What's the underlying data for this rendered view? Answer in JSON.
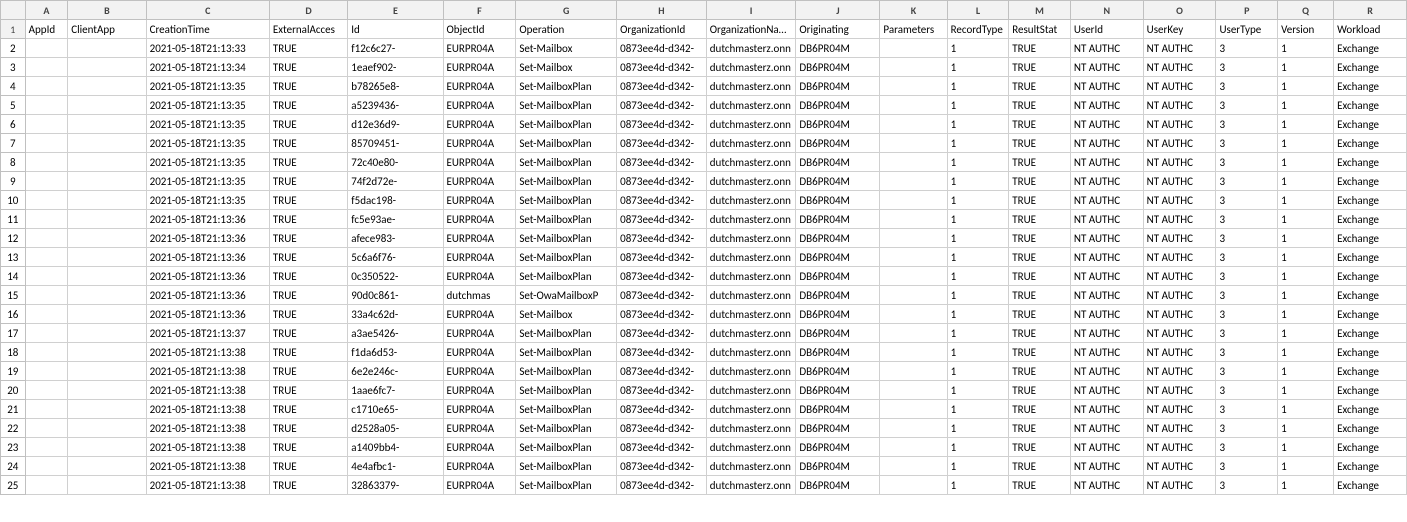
{
  "columns": {
    "letters": [
      "",
      "A",
      "B",
      "C",
      "D",
      "E",
      "F",
      "G",
      "H",
      "I",
      "J",
      "K",
      "L",
      "M",
      "N",
      "O",
      "P",
      "Q",
      "R"
    ],
    "headers": [
      "",
      "AppId",
      "ClientApp",
      "CreationTime",
      "ExternalAcces",
      "Id",
      "ObjectId",
      "Operation",
      "OrganizationId",
      "OrganizationName",
      "Originating",
      "Parameters",
      "RecordType",
      "ResultStat",
      "UserId",
      "UserKey",
      "UserType",
      "Version",
      "Workload"
    ]
  },
  "rows": [
    [
      "2",
      "",
      "",
      "2021-05-18T21:13:33",
      "TRUE",
      "f12c6c27-",
      "EURPR04A",
      "Set-Mailbox",
      "0873ee4d-d342-",
      "dutchmasterz.onn",
      "DB6PR04M",
      "",
      "1",
      "TRUE",
      "NT AUTHC",
      "NT AUTHC",
      "3",
      "1",
      "Exchange"
    ],
    [
      "3",
      "",
      "",
      "2021-05-18T21:13:34",
      "TRUE",
      "1eaef902-",
      "EURPR04A",
      "Set-Mailbox",
      "0873ee4d-d342-",
      "dutchmasterz.onn",
      "DB6PR04M",
      "",
      "1",
      "TRUE",
      "NT AUTHC",
      "NT AUTHC",
      "3",
      "1",
      "Exchange"
    ],
    [
      "4",
      "",
      "",
      "2021-05-18T21:13:35",
      "TRUE",
      "b78265e8-",
      "EURPR04A",
      "Set-MailboxPlan",
      "0873ee4d-d342-",
      "dutchmasterz.onn",
      "DB6PR04M",
      "",
      "1",
      "TRUE",
      "NT AUTHC",
      "NT AUTHC",
      "3",
      "1",
      "Exchange"
    ],
    [
      "5",
      "",
      "",
      "2021-05-18T21:13:35",
      "TRUE",
      "a5239436-",
      "EURPR04A",
      "Set-MailboxPlan",
      "0873ee4d-d342-",
      "dutchmasterz.onn",
      "DB6PR04M",
      "",
      "1",
      "TRUE",
      "NT AUTHC",
      "NT AUTHC",
      "3",
      "1",
      "Exchange"
    ],
    [
      "6",
      "",
      "",
      "2021-05-18T21:13:35",
      "TRUE",
      "d12e36d9-",
      "EURPR04A",
      "Set-MailboxPlan",
      "0873ee4d-d342-",
      "dutchmasterz.onn",
      "DB6PR04M",
      "",
      "1",
      "TRUE",
      "NT AUTHC",
      "NT AUTHC",
      "3",
      "1",
      "Exchange"
    ],
    [
      "7",
      "",
      "",
      "2021-05-18T21:13:35",
      "TRUE",
      "85709451-",
      "EURPR04A",
      "Set-MailboxPlan",
      "0873ee4d-d342-",
      "dutchmasterz.onn",
      "DB6PR04M",
      "",
      "1",
      "TRUE",
      "NT AUTHC",
      "NT AUTHC",
      "3",
      "1",
      "Exchange"
    ],
    [
      "8",
      "",
      "",
      "2021-05-18T21:13:35",
      "TRUE",
      "72c40e80-",
      "EURPR04A",
      "Set-MailboxPlan",
      "0873ee4d-d342-",
      "dutchmasterz.onn",
      "DB6PR04M",
      "",
      "1",
      "TRUE",
      "NT AUTHC",
      "NT AUTHC",
      "3",
      "1",
      "Exchange"
    ],
    [
      "9",
      "",
      "",
      "2021-05-18T21:13:35",
      "TRUE",
      "74f2d72e-",
      "EURPR04A",
      "Set-MailboxPlan",
      "0873ee4d-d342-",
      "dutchmasterz.onn",
      "DB6PR04M",
      "",
      "1",
      "TRUE",
      "NT AUTHC",
      "NT AUTHC",
      "3",
      "1",
      "Exchange"
    ],
    [
      "10",
      "",
      "",
      "2021-05-18T21:13:35",
      "TRUE",
      "f5dac198-",
      "EURPR04A",
      "Set-MailboxPlan",
      "0873ee4d-d342-",
      "dutchmasterz.onn",
      "DB6PR04M",
      "",
      "1",
      "TRUE",
      "NT AUTHC",
      "NT AUTHC",
      "3",
      "1",
      "Exchange"
    ],
    [
      "11",
      "",
      "",
      "2021-05-18T21:13:36",
      "TRUE",
      "fc5e93ae-",
      "EURPR04A",
      "Set-MailboxPlan",
      "0873ee4d-d342-",
      "dutchmasterz.onn",
      "DB6PR04M",
      "",
      "1",
      "TRUE",
      "NT AUTHC",
      "NT AUTHC",
      "3",
      "1",
      "Exchange"
    ],
    [
      "12",
      "",
      "",
      "2021-05-18T21:13:36",
      "TRUE",
      "afece983-",
      "EURPR04A",
      "Set-MailboxPlan",
      "0873ee4d-d342-",
      "dutchmasterz.onn",
      "DB6PR04M",
      "",
      "1",
      "TRUE",
      "NT AUTHC",
      "NT AUTHC",
      "3",
      "1",
      "Exchange"
    ],
    [
      "13",
      "",
      "",
      "2021-05-18T21:13:36",
      "TRUE",
      "5c6a6f76-",
      "EURPR04A",
      "Set-MailboxPlan",
      "0873ee4d-d342-",
      "dutchmasterz.onn",
      "DB6PR04M",
      "",
      "1",
      "TRUE",
      "NT AUTHC",
      "NT AUTHC",
      "3",
      "1",
      "Exchange"
    ],
    [
      "14",
      "",
      "",
      "2021-05-18T21:13:36",
      "TRUE",
      "0c350522-",
      "EURPR04A",
      "Set-MailboxPlan",
      "0873ee4d-d342-",
      "dutchmasterz.onn",
      "DB6PR04M",
      "",
      "1",
      "TRUE",
      "NT AUTHC",
      "NT AUTHC",
      "3",
      "1",
      "Exchange"
    ],
    [
      "15",
      "",
      "",
      "2021-05-18T21:13:36",
      "TRUE",
      "90d0c861-",
      "dutchmas",
      "Set-OwaMailboxP",
      "0873ee4d-d342-",
      "dutchmasterz.onn",
      "DB6PR04M",
      "",
      "1",
      "TRUE",
      "NT AUTHC",
      "NT AUTHC",
      "3",
      "1",
      "Exchange"
    ],
    [
      "16",
      "",
      "",
      "2021-05-18T21:13:36",
      "TRUE",
      "33a4c62d-",
      "EURPR04A",
      "Set-Mailbox",
      "0873ee4d-d342-",
      "dutchmasterz.onn",
      "DB6PR04M",
      "",
      "1",
      "TRUE",
      "NT AUTHC",
      "NT AUTHC",
      "3",
      "1",
      "Exchange"
    ],
    [
      "17",
      "",
      "",
      "2021-05-18T21:13:37",
      "TRUE",
      "a3ae5426-",
      "EURPR04A",
      "Set-MailboxPlan",
      "0873ee4d-d342-",
      "dutchmasterz.onn",
      "DB6PR04M",
      "",
      "1",
      "TRUE",
      "NT AUTHC",
      "NT AUTHC",
      "3",
      "1",
      "Exchange"
    ],
    [
      "18",
      "",
      "",
      "2021-05-18T21:13:38",
      "TRUE",
      "f1da6d53-",
      "EURPR04A",
      "Set-MailboxPlan",
      "0873ee4d-d342-",
      "dutchmasterz.onn",
      "DB6PR04M",
      "",
      "1",
      "TRUE",
      "NT AUTHC",
      "NT AUTHC",
      "3",
      "1",
      "Exchange"
    ],
    [
      "19",
      "",
      "",
      "2021-05-18T21:13:38",
      "TRUE",
      "6e2e246c-",
      "EURPR04A",
      "Set-MailboxPlan",
      "0873ee4d-d342-",
      "dutchmasterz.onn",
      "DB6PR04M",
      "",
      "1",
      "TRUE",
      "NT AUTHC",
      "NT AUTHC",
      "3",
      "1",
      "Exchange"
    ],
    [
      "20",
      "",
      "",
      "2021-05-18T21:13:38",
      "TRUE",
      "1aae6fc7-",
      "EURPR04A",
      "Set-MailboxPlan",
      "0873ee4d-d342-",
      "dutchmasterz.onn",
      "DB6PR04M",
      "",
      "1",
      "TRUE",
      "NT AUTHC",
      "NT AUTHC",
      "3",
      "1",
      "Exchange"
    ],
    [
      "21",
      "",
      "",
      "2021-05-18T21:13:38",
      "TRUE",
      "c1710e65-",
      "EURPR04A",
      "Set-MailboxPlan",
      "0873ee4d-d342-",
      "dutchmasterz.onn",
      "DB6PR04M",
      "",
      "1",
      "TRUE",
      "NT AUTHC",
      "NT AUTHC",
      "3",
      "1",
      "Exchange"
    ],
    [
      "22",
      "",
      "",
      "2021-05-18T21:13:38",
      "TRUE",
      "d2528a05-",
      "EURPR04A",
      "Set-MailboxPlan",
      "0873ee4d-d342-",
      "dutchmasterz.onn",
      "DB6PR04M",
      "",
      "1",
      "TRUE",
      "NT AUTHC",
      "NT AUTHC",
      "3",
      "1",
      "Exchange"
    ],
    [
      "23",
      "",
      "",
      "2021-05-18T21:13:38",
      "TRUE",
      "a1409bb4-",
      "EURPR04A",
      "Set-MailboxPlan",
      "0873ee4d-d342-",
      "dutchmasterz.onn",
      "DB6PR04M",
      "",
      "1",
      "TRUE",
      "NT AUTHC",
      "NT AUTHC",
      "3",
      "1",
      "Exchange"
    ],
    [
      "24",
      "",
      "",
      "2021-05-18T21:13:38",
      "TRUE",
      "4e4afbc1-",
      "EURPR04A",
      "Set-MailboxPlan",
      "0873ee4d-d342-",
      "dutchmasterz.onn",
      "DB6PR04M",
      "",
      "1",
      "TRUE",
      "NT AUTHC",
      "NT AUTHC",
      "3",
      "1",
      "Exchange"
    ],
    [
      "25",
      "",
      "",
      "2021-05-18T21:13:38",
      "TRUE",
      "32863379-",
      "EURPR04A",
      "Set-MailboxPlan",
      "0873ee4d-d342-",
      "dutchmasterz.onn",
      "DB6PR04M",
      "",
      "1",
      "TRUE",
      "NT AUTHC",
      "NT AUTHC",
      "3",
      "1",
      "Exchange"
    ]
  ]
}
